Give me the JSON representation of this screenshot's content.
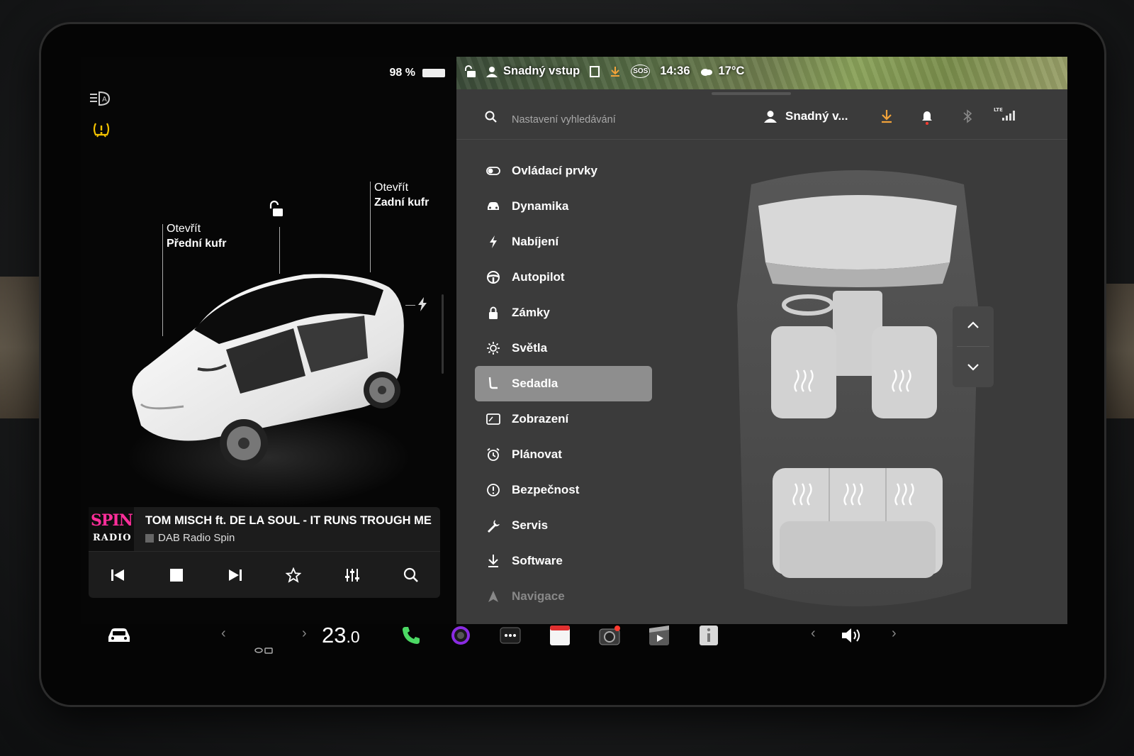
{
  "status_bar": {
    "battery_percent": "98 %",
    "profile_name": "Snadný vstup",
    "time": "14:36",
    "temperature": "17°C",
    "sos_label": "SOS"
  },
  "left_panel": {
    "frunk_action": "Otevřít",
    "frunk_label": "Přední kufr",
    "trunk_action": "Otevřít",
    "trunk_label": "Zadní kufr"
  },
  "media": {
    "logo_top": "SPIN",
    "logo_bottom": "RADIO",
    "track_title": "TOM MISCH ft. DE LA SOUL - IT RUNS TROUGH ME",
    "station": "DAB Radio Spin"
  },
  "settings": {
    "search_placeholder": "Nastavení vyhledávání",
    "profile_short": "Snadný v...",
    "menu": [
      {
        "label": "Ovládací prvky",
        "icon": "toggle-icon"
      },
      {
        "label": "Dynamika",
        "icon": "car-icon"
      },
      {
        "label": "Nabíjení",
        "icon": "bolt-icon"
      },
      {
        "label": "Autopilot",
        "icon": "steering-wheel-icon"
      },
      {
        "label": "Zámky",
        "icon": "lock-icon"
      },
      {
        "label": "Světla",
        "icon": "sun-icon"
      },
      {
        "label": "Sedadla",
        "icon": "seat-icon"
      },
      {
        "label": "Zobrazení",
        "icon": "display-icon"
      },
      {
        "label": "Plánovat",
        "icon": "alarm-clock-icon"
      },
      {
        "label": "Bezpečnost",
        "icon": "alert-icon"
      },
      {
        "label": "Servis",
        "icon": "wrench-icon"
      },
      {
        "label": "Software",
        "icon": "download-icon"
      },
      {
        "label": "Navigace",
        "icon": "navigation-icon"
      }
    ],
    "active_item": "Sedadla"
  },
  "dock": {
    "cabin_temp_int": "23",
    "cabin_temp_dec": ".0"
  },
  "colors": {
    "accent_orange": "#f2a33a",
    "tpms_yellow": "#f2c100",
    "phone_green": "#4cd964",
    "spin_pink": "#ff2e9a"
  }
}
